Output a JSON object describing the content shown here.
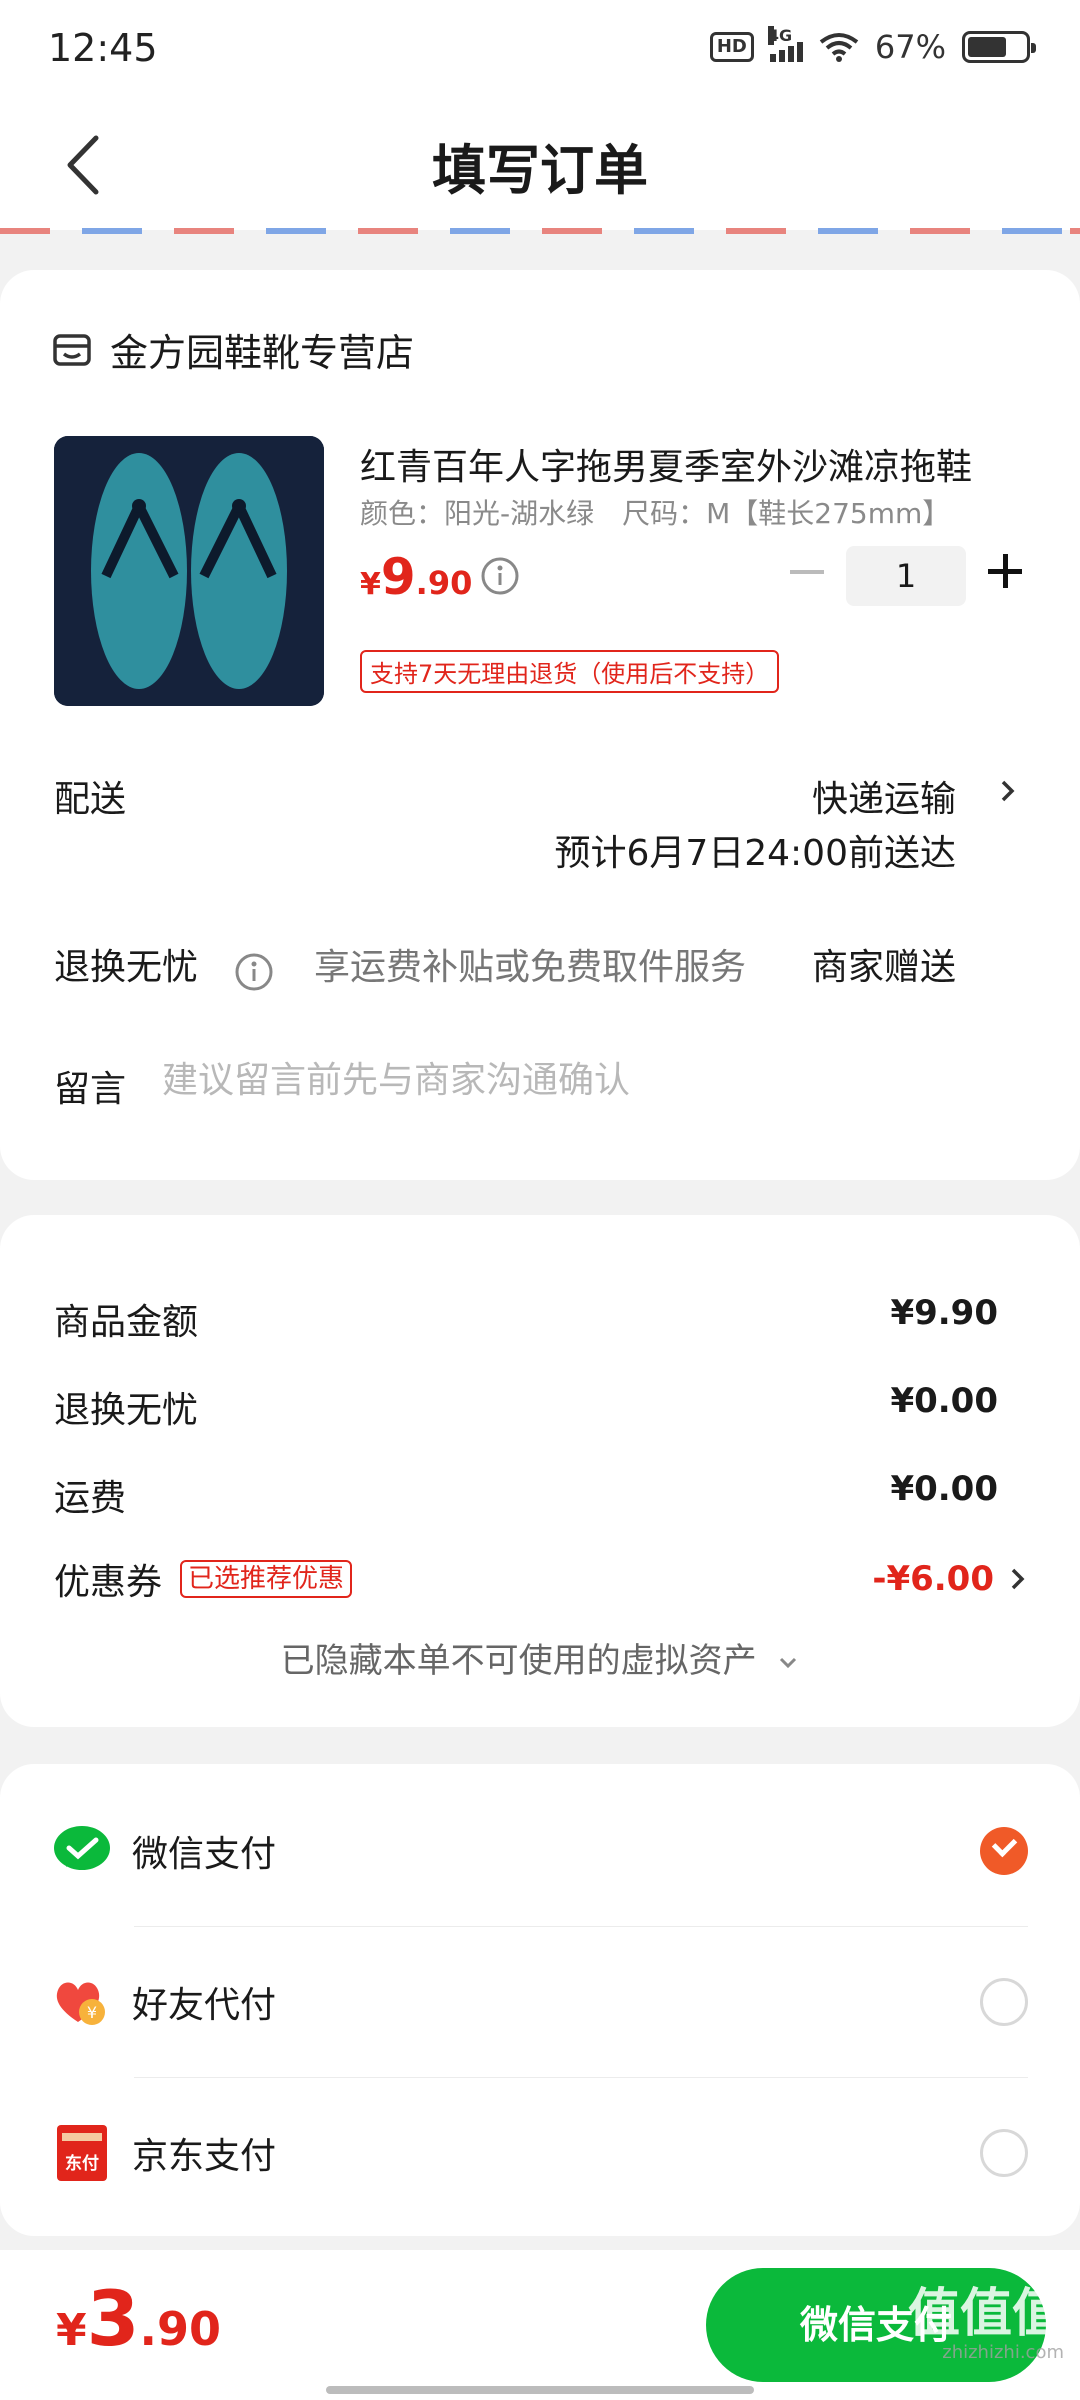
{
  "status_bar": {
    "time": "12:45",
    "hd": "HD",
    "network": "4G",
    "battery": "67%",
    "battery_level": 0.67
  },
  "header": {
    "title": "填写订单",
    "back_icon": "chevron-left-icon"
  },
  "store": {
    "name": "金方园鞋靴专营店",
    "icon": "store-icon"
  },
  "product": {
    "name": "红青百年人字拖男夏季室外沙滩凉拖鞋",
    "spec": "颜色：阳光-湖水绿　尺码：M【鞋长275mm】",
    "price_symbol": "¥",
    "price_int": "9",
    "price_dec": ".90",
    "quantity": "1",
    "return_tag": "支持7天无理由退货（使用后不支持）"
  },
  "delivery": {
    "label": "配送",
    "method": "快递运输",
    "eta": "预计6月7日24:00前送达"
  },
  "return_service": {
    "label": "退换无忧",
    "desc": "享运费补贴或免费取件服务",
    "value": "商家赠送"
  },
  "message": {
    "label": "留言",
    "placeholder": "建议留言前先与商家沟通确认"
  },
  "summary": {
    "goods_label": "商品金额",
    "goods_value": "¥9.90",
    "return_label": "退换无忧",
    "return_value": "¥0.00",
    "shipping_label": "运费",
    "shipping_value": "¥0.00",
    "coupon_label": "优惠券",
    "coupon_tag": "已选推荐优惠",
    "coupon_value": "-¥6.00",
    "hidden_assets": "已隐藏本单不可使用的虚拟资产"
  },
  "payment": [
    {
      "label": "微信支付",
      "icon": "wechat-pay-icon",
      "selected": true
    },
    {
      "label": "好友代付",
      "icon": "friend-pay-icon",
      "selected": false
    },
    {
      "label": "京东支付",
      "icon": "jd-pay-icon",
      "selected": false
    }
  ],
  "jd_icon_text": "东付",
  "friend_icon_text": "¥",
  "bottom": {
    "symbol": "¥",
    "total_int": "3",
    "total_dec": ".90",
    "pay_button": "微信支付"
  },
  "watermark": {
    "text": "值值值",
    "sub": "zhizhizhi.com"
  },
  "colors": {
    "accent_red": "#e1251b",
    "wechat_green": "#0bb93b",
    "radio_selected": "#f05a28"
  }
}
